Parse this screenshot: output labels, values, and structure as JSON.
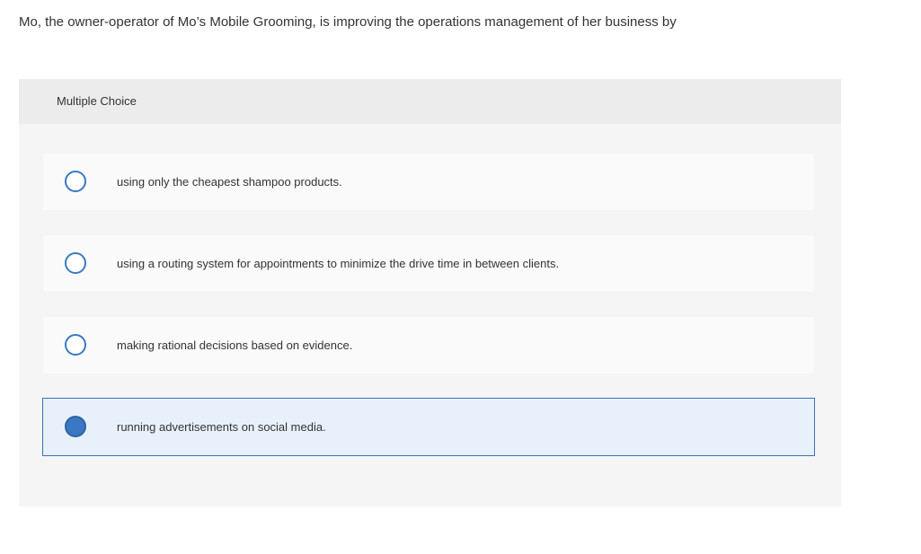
{
  "question": {
    "text": "Mo, the owner-operator of Mo’s Mobile Grooming, is improving the operations management of her business by"
  },
  "panel": {
    "label": "Multiple Choice"
  },
  "choices": [
    {
      "text": "using only the cheapest shampoo products.",
      "selected": false
    },
    {
      "text": "using a routing system for appointments to minimize the drive time in between clients.",
      "selected": false
    },
    {
      "text": "making rational decisions based on evidence.",
      "selected": false
    },
    {
      "text": "running advertisements on social media.",
      "selected": true
    }
  ],
  "colors": {
    "accent": "#3a78c3",
    "selected_background": "#e8f1fb",
    "panel_background": "#f5f5f5",
    "header_background": "#ececec"
  }
}
